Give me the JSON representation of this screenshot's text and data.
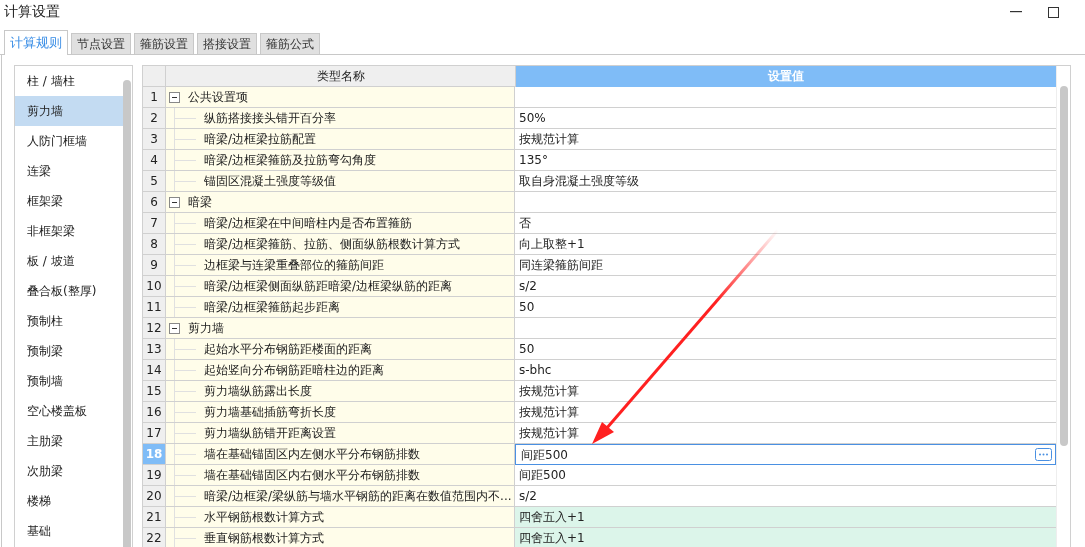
{
  "window": {
    "title": "计算设置"
  },
  "tabs": [
    {
      "label": "计算规则",
      "selected": true
    },
    {
      "label": "节点设置",
      "selected": false
    },
    {
      "label": "箍筋设置",
      "selected": false
    },
    {
      "label": "搭接设置",
      "selected": false
    },
    {
      "label": "箍筋公式",
      "selected": false
    }
  ],
  "sidebar": {
    "items": [
      {
        "label": "柱 / 墙柱",
        "selected": false
      },
      {
        "label": "剪力墙",
        "selected": true
      },
      {
        "label": "人防门框墙",
        "selected": false
      },
      {
        "label": "连梁",
        "selected": false
      },
      {
        "label": "框架梁",
        "selected": false
      },
      {
        "label": "非框架梁",
        "selected": false
      },
      {
        "label": "板 / 坡道",
        "selected": false
      },
      {
        "label": "叠合板(整厚)",
        "selected": false
      },
      {
        "label": "预制柱",
        "selected": false
      },
      {
        "label": "预制梁",
        "selected": false
      },
      {
        "label": "预制墙",
        "selected": false
      },
      {
        "label": "空心楼盖板",
        "selected": false
      },
      {
        "label": "主肋梁",
        "selected": false
      },
      {
        "label": "次肋梁",
        "selected": false
      },
      {
        "label": "楼梯",
        "selected": false
      },
      {
        "label": "基础",
        "selected": false
      }
    ]
  },
  "table": {
    "columns": [
      "类型名称",
      "设置值"
    ],
    "rows": [
      {
        "kind": "group",
        "num": "1",
        "name": "公共设置项",
        "expanded": true,
        "selected": false
      },
      {
        "kind": "item",
        "num": "2",
        "name": "纵筋搭接接头错开百分率",
        "value": "50%",
        "selected": false
      },
      {
        "kind": "item",
        "num": "3",
        "name": "暗梁/边框梁拉筋配置",
        "value": "按规范计算",
        "selected": false
      },
      {
        "kind": "item",
        "num": "4",
        "name": "暗梁/边框梁箍筋及拉筋弯勾角度",
        "value": "135°",
        "selected": false
      },
      {
        "kind": "item",
        "num": "5",
        "name": "锚固区混凝土强度等级值",
        "value": "取自身混凝土强度等级",
        "selected": false
      },
      {
        "kind": "group",
        "num": "6",
        "name": "暗梁",
        "expanded": true,
        "selected": false
      },
      {
        "kind": "item",
        "num": "7",
        "name": "暗梁/边框梁在中间暗柱内是否布置箍筋",
        "value": "否",
        "selected": false
      },
      {
        "kind": "item",
        "num": "8",
        "name": "暗梁/边框梁箍筋、拉筋、侧面纵筋根数计算方式",
        "value": "向上取整+1",
        "selected": false
      },
      {
        "kind": "item",
        "num": "9",
        "name": "边框梁与连梁重叠部位的箍筋间距",
        "value": "同连梁箍筋间距",
        "selected": false
      },
      {
        "kind": "item",
        "num": "10",
        "name": "暗梁/边框梁侧面纵筋距暗梁/边框梁纵筋的距离",
        "value": "s/2",
        "selected": false
      },
      {
        "kind": "item",
        "num": "11",
        "name": "暗梁/边框梁箍筋起步距离",
        "value": "50",
        "selected": false
      },
      {
        "kind": "group",
        "num": "12",
        "name": "剪力墙",
        "expanded": true,
        "selected": false
      },
      {
        "kind": "item",
        "num": "13",
        "name": "起始水平分布钢筋距楼面的距离",
        "value": "50",
        "selected": false
      },
      {
        "kind": "item",
        "num": "14",
        "name": "起始竖向分布钢筋距暗柱边的距离",
        "value": "s-bhc",
        "selected": false
      },
      {
        "kind": "item",
        "num": "15",
        "name": "剪力墙纵筋露出长度",
        "value": "按规范计算",
        "selected": false
      },
      {
        "kind": "item",
        "num": "16",
        "name": "剪力墙基础插筋弯折长度",
        "value": "按规范计算",
        "selected": false
      },
      {
        "kind": "item",
        "num": "17",
        "name": "剪力墙纵筋错开距离设置",
        "value": "按规范计算",
        "selected": false
      },
      {
        "kind": "item",
        "num": "18",
        "name": "墙在基础锚固区内左侧水平分布钢筋排数",
        "value": "间距500",
        "selected": true
      },
      {
        "kind": "item",
        "num": "19",
        "name": "墙在基础锚固区内右侧水平分布钢筋排数",
        "value": "间距500",
        "selected": false
      },
      {
        "kind": "item",
        "num": "20",
        "name": "暗梁/边框梁/梁纵筋与墙水平钢筋的距离在数值范围内不...",
        "value": "s/2",
        "selected": false
      },
      {
        "kind": "item",
        "num": "21",
        "name": "水平钢筋根数计算方式",
        "value": "四舍五入+1",
        "selected": false,
        "modified": true
      },
      {
        "kind": "item",
        "num": "22",
        "name": "垂直钢筋根数计算方式",
        "value": "四舍五入+1",
        "selected": false,
        "modified": true
      }
    ]
  }
}
